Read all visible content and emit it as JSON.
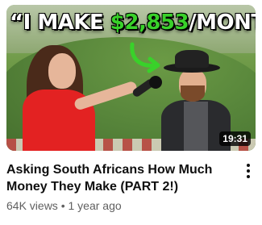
{
  "thumbnail": {
    "headline_prefix": "“I MAKE ",
    "headline_money": "$2,853",
    "headline_suffix": "/MONTH”",
    "duration": "19:31",
    "money_color": "#39d12a"
  },
  "video": {
    "title": "Asking South Africans How Much Money They Make (PART 2!)",
    "views": "64K views",
    "separator": "•",
    "age": "1 year ago"
  },
  "icons": {
    "more_actions": "more-vert-icon",
    "arrow": "arrow-icon"
  }
}
